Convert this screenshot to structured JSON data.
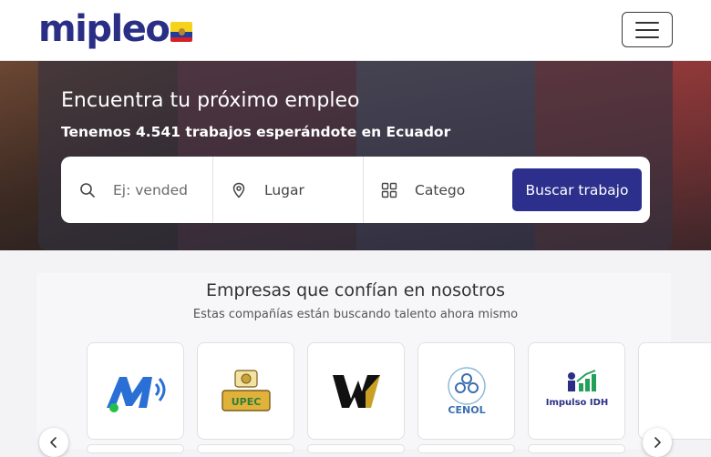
{
  "brand": {
    "logo_text": "mipleo",
    "flag": "Ecuador flag",
    "colors": {
      "primary": "#2c2f8c",
      "logo": "#2a2f85"
    }
  },
  "navbar": {
    "menu_icon": "hamburger-menu-icon"
  },
  "hero": {
    "title": "Encuentra tu próximo empleo",
    "subtitle": "Tenemos 4.541 trabajos esperándote en Ecuador"
  },
  "search": {
    "keyword": {
      "icon": "search-icon",
      "placeholder": "Ej: vended"
    },
    "location": {
      "icon": "map-pin-icon",
      "value": "Lugar"
    },
    "category": {
      "icon": "category-grid-icon",
      "value": "Catego"
    },
    "submit_label": "Buscar trabajo"
  },
  "companies": {
    "title": "Empresas que confían en nosotros",
    "subtitle": "Estas compañías están buscando talento ahora mismo",
    "logos": [
      {
        "name": "M logo"
      },
      {
        "name": "UPEC logo",
        "text": "UPEC"
      },
      {
        "name": "W logo"
      },
      {
        "name": "CENOL logo",
        "text": "CENOL"
      },
      {
        "name": "Impulso IDH logo",
        "text": "Impulso IDH"
      }
    ],
    "prev_icon": "chevron-left-icon",
    "next_icon": "chevron-right-icon"
  }
}
